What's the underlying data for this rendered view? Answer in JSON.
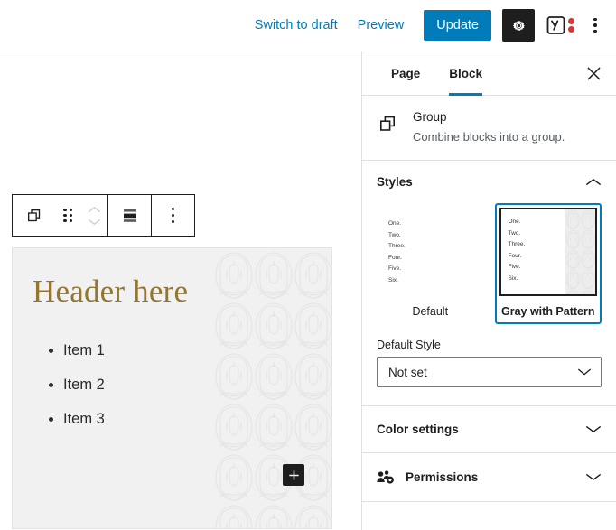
{
  "topbar": {
    "switch_to_draft": "Switch to draft",
    "preview": "Preview",
    "update": "Update",
    "settings_icon": "gear-icon",
    "yoast_icon": "yoast-seo-icon",
    "more_icon": "kebab-menu-icon",
    "accent_color": "#007cba"
  },
  "block_toolbar": {
    "block_type_icon": "group-icon",
    "drag_icon": "drag-handle-icon",
    "move_up_icon": "chevron-up-icon",
    "move_down_icon": "chevron-down-icon",
    "align_icon": "align-center-icon",
    "options_icon": "kebab-menu-icon"
  },
  "canvas": {
    "group_block": {
      "heading": "Header here",
      "list_items": [
        "Item 1",
        "Item 2",
        "Item 3"
      ],
      "heading_color": "#94762f",
      "background_color": "#f1f1f1",
      "add_block_label": "+"
    }
  },
  "sidebar": {
    "tabs": [
      {
        "label": "Page",
        "active": false
      },
      {
        "label": "Block",
        "active": true
      }
    ],
    "close_icon": "close-icon",
    "block_card": {
      "icon": "group-icon",
      "title": "Group",
      "description": "Combine blocks into a group."
    },
    "styles_panel": {
      "title": "Styles",
      "expanded": true,
      "chevron": "chevron-up-icon",
      "preview_lines": [
        "One.",
        "Two.",
        "Three.",
        "Four.",
        "Five.",
        "Six."
      ],
      "options": [
        {
          "label": "Default",
          "selected": false
        },
        {
          "label": "Gray with Pattern",
          "selected": true
        }
      ],
      "default_style_label": "Default Style",
      "default_style_value": "Not set",
      "select_chevron": "chevron-down-icon"
    },
    "color_panel": {
      "title": "Color settings",
      "expanded": false,
      "chevron": "chevron-down-icon"
    },
    "permissions_panel": {
      "title": "Permissions",
      "icon": "users-gear-icon",
      "expanded": false,
      "chevron": "chevron-down-icon"
    }
  }
}
